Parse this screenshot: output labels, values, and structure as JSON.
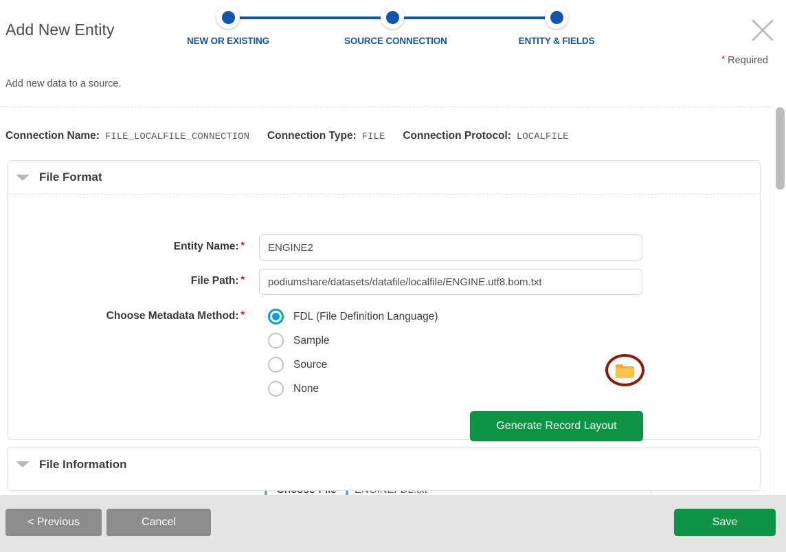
{
  "dialog": {
    "title": "Add New Entity",
    "subtitle": "Add new data to a source.",
    "required_note": "Required",
    "required_marker": "*",
    "close_icon": "close-icon"
  },
  "stepper": {
    "accent_color": "#1154ad",
    "steps": [
      {
        "label": "NEW OR EXISTING",
        "state": "complete"
      },
      {
        "label": "SOURCE CONNECTION",
        "state": "complete"
      },
      {
        "label": "ENTITY & FIELDS",
        "state": "active"
      }
    ]
  },
  "connection": {
    "name_label": "Connection Name:",
    "name_value": "FILE_LOCALFILE_CONNECTION",
    "type_label": "Connection Type:",
    "type_value": "FILE",
    "protocol_label": "Connection Protocol:",
    "protocol_value": "LOCALFILE"
  },
  "sections": {
    "file_format": {
      "title": "File Format",
      "caret_icon": "chevron-down-icon",
      "expanded": true
    },
    "file_information": {
      "title": "File Information",
      "caret_icon": "chevron-down-icon",
      "expanded": false
    }
  },
  "form": {
    "entity_name": {
      "label": "Entity Name:",
      "required": "*",
      "value": "ENGINE2",
      "placeholder": ""
    },
    "file_path": {
      "label": "File Path:",
      "required": "*",
      "value": "podiumshare/datasets/datafile/localfile/ENGINE.utf8.bom.txt",
      "placeholder": "",
      "browse_icon": "folder-icon",
      "highlight_color": "#8d1b07",
      "folder_color": "#f6b43a"
    },
    "metadata_method": {
      "label": "Choose Metadata Method:",
      "required": "*",
      "selected": "FDL (File Definition Language)",
      "accent_color": "#00a0dc",
      "options": [
        {
          "label": "FDL (File Definition Language)",
          "checked": true
        },
        {
          "label": "Sample",
          "checked": false
        },
        {
          "label": "Source",
          "checked": false
        },
        {
          "label": "None",
          "checked": false
        }
      ]
    },
    "generate_record_layout": {
      "label": "Generate Record Layout",
      "color": "#0e9347"
    },
    "file_upload": {
      "button_label": "Choose File",
      "filename": "ENGINEFDL.txt",
      "focused": true
    }
  },
  "footer": {
    "previous_label": "< Previous",
    "cancel_label": "Cancel",
    "save_label": "Save",
    "save_color": "#0e9347",
    "neutral_color": "#8c8c8c"
  },
  "scrollbar": {
    "orientation": "vertical",
    "thumb_position_pct": 0
  }
}
